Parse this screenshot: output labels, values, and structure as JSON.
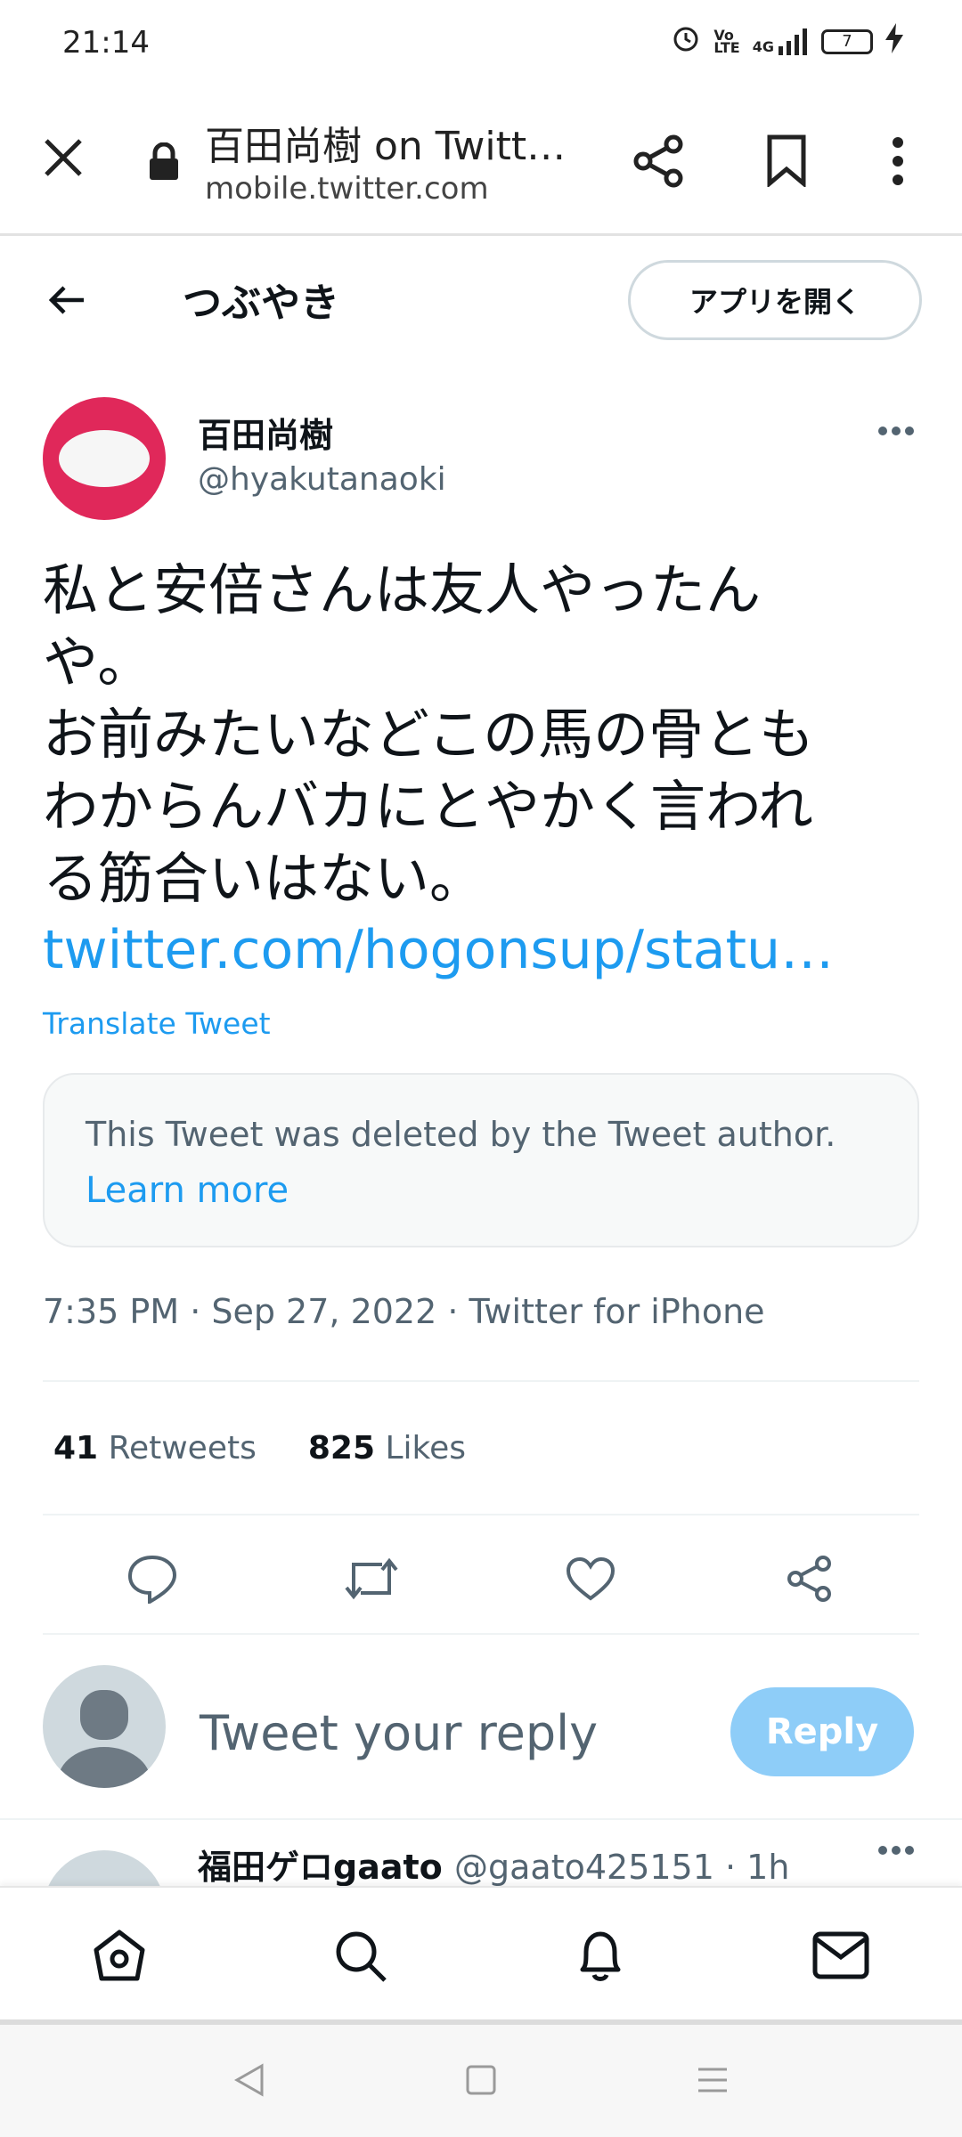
{
  "status_bar": {
    "time": "21:14",
    "battery": "7",
    "network": "4G"
  },
  "browser": {
    "title": "百田尚樹 on Twitt…",
    "host": "mobile.twitter.com"
  },
  "header": {
    "title": "つぶやき",
    "open_app_label": "アプリを開く"
  },
  "tweet": {
    "author_name": "百田尚樹",
    "author_handle": "@hyakutanaoki",
    "text": "私と安倍さんは友人やったん\nや。\nお前みたいなどこの馬の骨とも\nわからんバカにとやかく言われ\nる筋合いはない。",
    "link": "twitter.com/hogonsup/statu…",
    "translate_label": "Translate Tweet",
    "quoted_notice": "This Tweet was deleted by the Tweet author.",
    "learn_more_label": "Learn more",
    "meta": "7:35 PM · Sep 27, 2022 · Twitter for iPhone",
    "retweets_count": "41",
    "retweets_label": "Retweets",
    "likes_count": "825",
    "likes_label": "Likes"
  },
  "reply_composer": {
    "placeholder": "Tweet your reply",
    "button_label": "Reply"
  },
  "next_tweet": {
    "name": "福田ゲロgaato",
    "handle": "@gaato425151 · 1h"
  },
  "colors": {
    "accent": "#1d9bf0",
    "reply_button_disabled": "#8ecdf8",
    "avatar_bg": "#e0285a"
  }
}
